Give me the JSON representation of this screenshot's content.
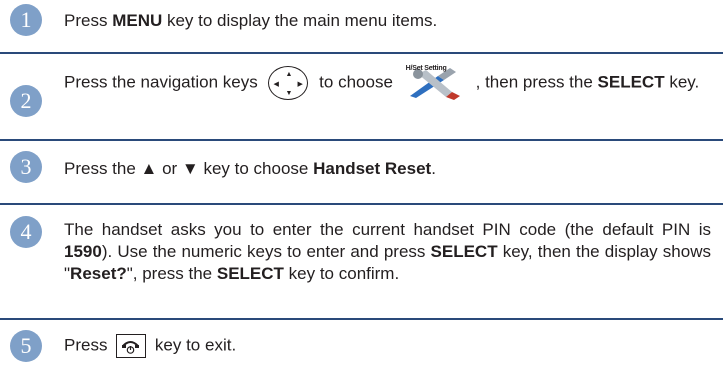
{
  "steps": [
    {
      "number": "1",
      "parts": [
        "Press ",
        "MENU",
        " key to display the main menu items."
      ]
    },
    {
      "number": "2",
      "parts": [
        "Press the navigation keys ",
        " to choose ",
        ", then press the ",
        "SELECT",
        " key."
      ]
    },
    {
      "number": "3",
      "parts": [
        "Press the ▲ or ▼ key to choose ",
        "Handset Reset",
        "."
      ]
    },
    {
      "number": "4",
      "parts": [
        "The handset asks you to enter the current handset PIN code (the default PIN is ",
        "1590",
        "). Use the numeric keys to enter and press ",
        "SELECT",
        " key, then the display shows \"",
        "Reset?",
        "\", press the ",
        "SELECT",
        " key to confirm."
      ]
    },
    {
      "number": "5",
      "parts": [
        "Press ",
        " key to exit."
      ]
    }
  ],
  "icons": {
    "nav_keys": "navigation-keys-icon",
    "hset_setting": "handset-setting-icon",
    "hset_setting_label": "H/Set Setting",
    "end_key": "end-key-icon"
  },
  "colors": {
    "badge": "#7fa0c8",
    "rule": "#2a4a7a"
  }
}
